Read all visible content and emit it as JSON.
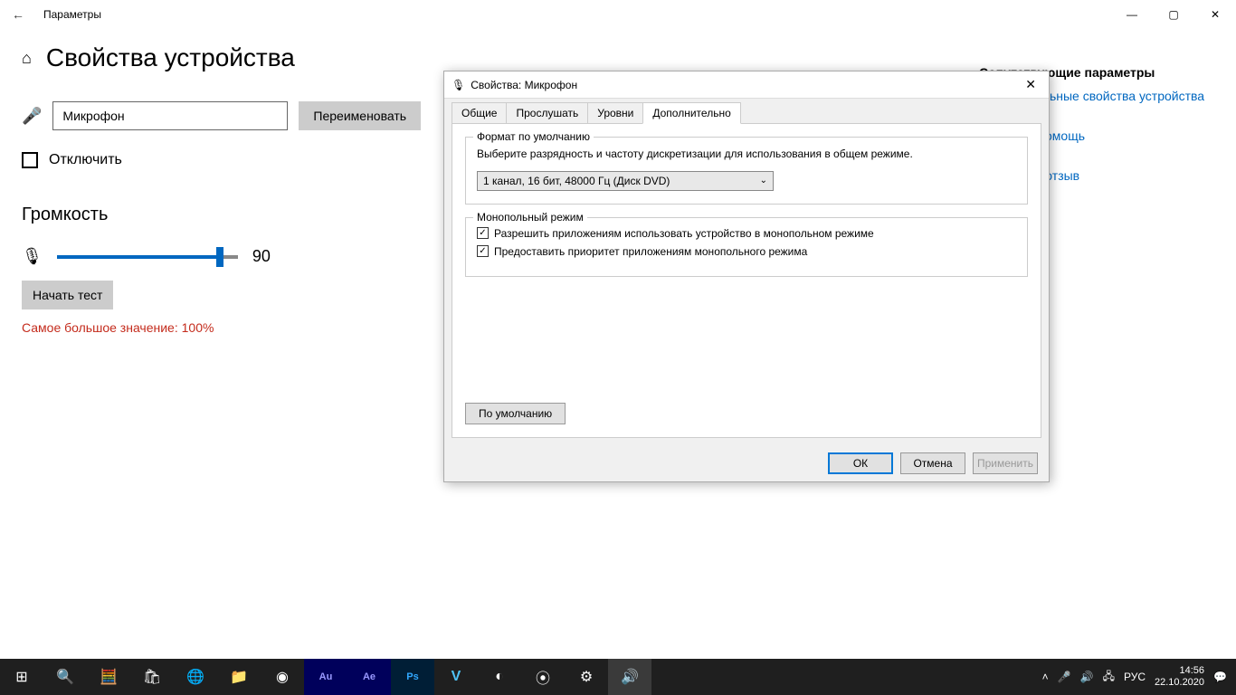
{
  "settings": {
    "window_title": "Параметры",
    "page_title": "Свойства устройства",
    "device_name": "Микрофон",
    "rename_btn": "Переименовать",
    "disable_label": "Отключить",
    "volume_heading": "Громкость",
    "volume_value": "90",
    "start_test_btn": "Начать тест",
    "max_value_text": "Самое большое значение: 100%"
  },
  "right_panel": {
    "related_heading": "Сопутствующие параметры",
    "link_additional": "Дополнительные свойства устройства",
    "help_heading": "Получить помощь",
    "feedback_heading": "Отправить отзыв"
  },
  "dialog": {
    "title": "Свойства: Микрофон",
    "tabs": [
      "Общие",
      "Прослушать",
      "Уровни",
      "Дополнительно"
    ],
    "active_tab": 3,
    "format_group": {
      "legend": "Формат по умолчанию",
      "desc": "Выберите разрядность и частоту дискретизации для использования в общем режиме.",
      "combo_value": "1 канал, 16 бит, 48000 Гц (Диск DVD)"
    },
    "exclusive_group": {
      "legend": "Монопольный режим",
      "check1": "Разрешить приложениям использовать устройство в монопольном режиме",
      "check2": "Предоставить приоритет приложениям монопольного режима"
    },
    "default_btn": "По умолчанию",
    "ok_btn": "ОК",
    "cancel_btn": "Отмена",
    "apply_btn": "Применить"
  },
  "taskbar": {
    "lang": "РУС",
    "time": "14:56",
    "date": "22.10.2020"
  }
}
